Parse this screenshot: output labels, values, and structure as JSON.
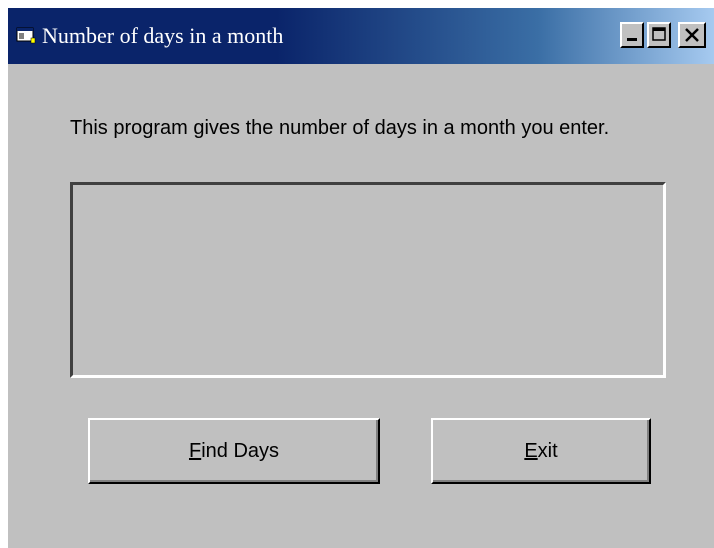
{
  "window": {
    "title": "Number of days in a month",
    "controls": {
      "minimize_icon": "minimize-icon",
      "maximize_icon": "maximize-icon",
      "close_icon": "close-icon"
    },
    "colors": {
      "titlebar_start": "#0a246a",
      "titlebar_end": "#a6caf0",
      "face": "#c0c0c0"
    }
  },
  "main": {
    "description": "This program gives the number of days in a month you enter.",
    "output_text": ""
  },
  "buttons": {
    "find_days": {
      "accel": "F",
      "rest": "ind Days"
    },
    "exit": {
      "accel": "E",
      "rest": "xit"
    }
  }
}
